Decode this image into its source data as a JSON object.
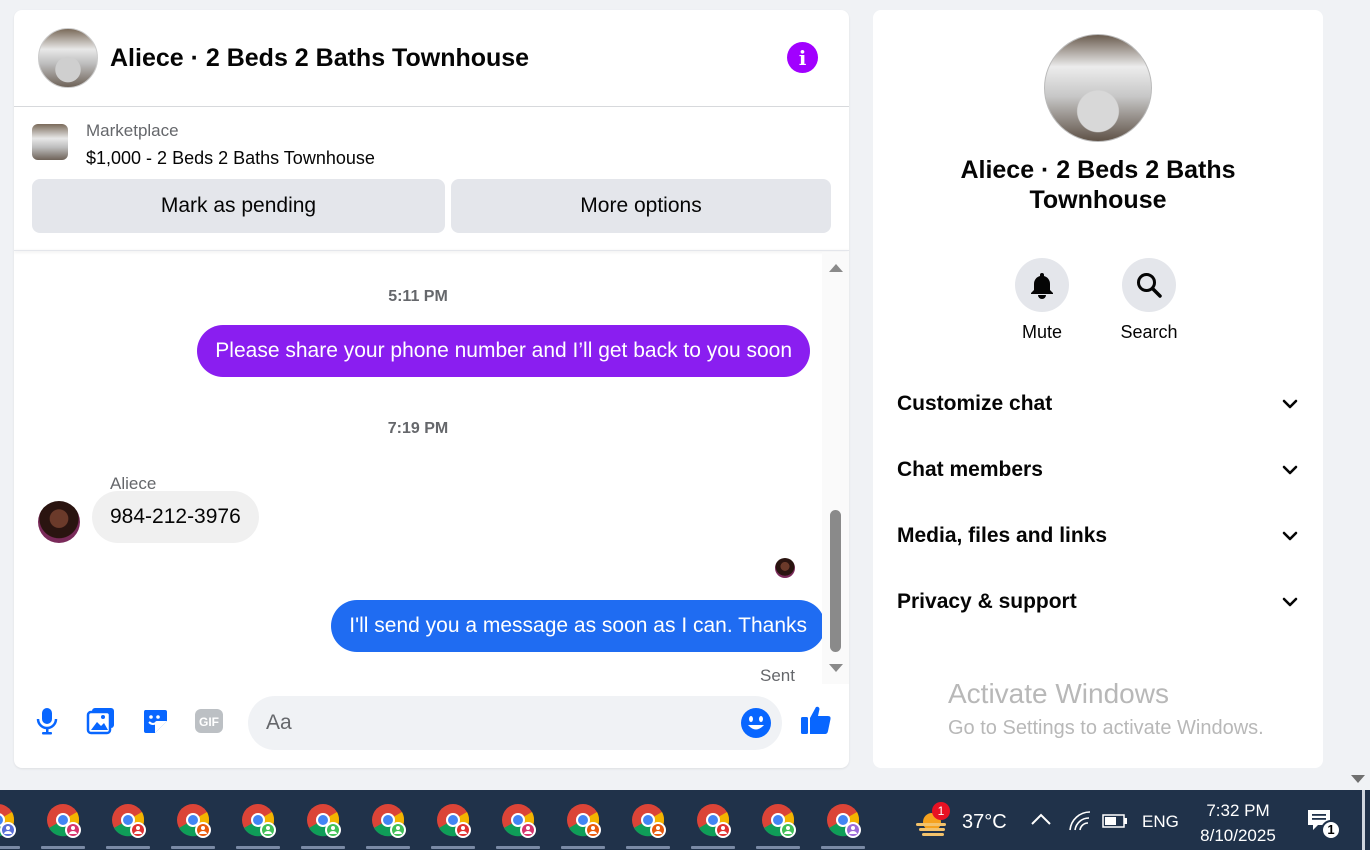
{
  "chat": {
    "title": "Aliece · 2 Beds 2 Baths Townhouse",
    "listing_label": "Marketplace",
    "listing_price": "$1,000 - 2 Beds 2 Baths Townhouse",
    "mark_pending_label": "Mark as pending",
    "more_options_label": "More options"
  },
  "messages": {
    "time1": "5:11 PM",
    "msg1": "Please share your phone number and I’ll get back to you soon",
    "time2": "7:19 PM",
    "sender": "Aliece",
    "msg2": "984-212-3976",
    "msg3": "I'll send you a message as soon as I can. Thanks",
    "status": "Sent"
  },
  "composer": {
    "placeholder": "Aa",
    "icons": [
      "microphone-icon",
      "photo-icon",
      "sticker-icon",
      "gif-icon",
      "emoji-icon",
      "thumbs-up-icon"
    ]
  },
  "info": {
    "title": "Aliece · 2 Beds 2 Baths Townhouse",
    "mute_label": "Mute",
    "search_label": "Search",
    "sections": [
      "Customize chat",
      "Chat members",
      "Media, files and links",
      "Privacy & support"
    ]
  },
  "watermark": {
    "title": "Activate Windows",
    "subtitle": "Go to Settings to activate Windows."
  },
  "taskbar": {
    "weather_badge": "1",
    "temperature": "37°C",
    "language": "ENG",
    "time": "7:32 PM",
    "date": "8/10/2025",
    "notification_count": "1"
  },
  "colors": {
    "accent_purple": "#8a1ef0",
    "accent_blue": "#1f6cf2",
    "info_icon": "#a100ff",
    "taskbar": "#20324a"
  }
}
